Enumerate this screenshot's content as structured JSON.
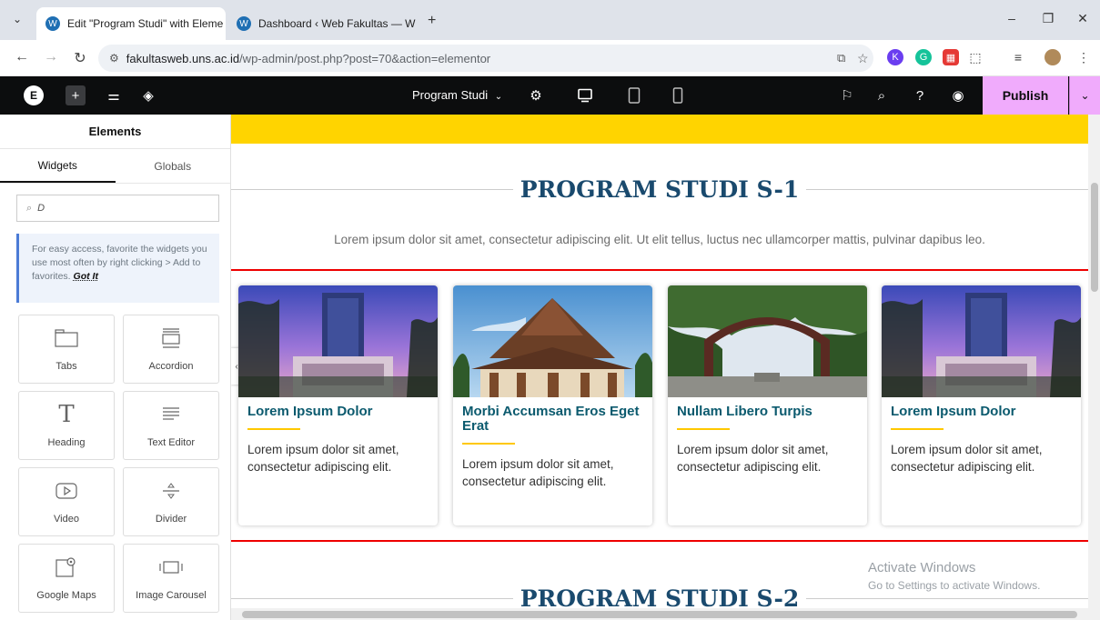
{
  "browser": {
    "tabs": [
      {
        "title": "Edit \"Program Studi\" with Eleme",
        "active": true
      },
      {
        "title": "Dashboard ‹ Web Fakultas — W",
        "active": false
      }
    ],
    "new_tab": "+",
    "url_host": "fakultasweb.uns.ac.id",
    "url_path": "/wp-admin/post.php?post=70&action=elementor"
  },
  "editor": {
    "document_name": "Program Studi",
    "publish_label": "Publish"
  },
  "panel": {
    "title": "Elements",
    "tabs": [
      "Widgets",
      "Globals"
    ],
    "search_value": "D",
    "note_text": "For easy access, favorite the widgets you use most often by right clicking > Add to favorites.",
    "note_link": "Got It",
    "widgets": [
      "Tabs",
      "Accordion",
      "Heading",
      "Text Editor",
      "Video",
      "Divider",
      "Google Maps",
      "Image Carousel"
    ]
  },
  "canvas": {
    "section1_title": "PROGRAM STUDI S-1",
    "section1_lead": "Lorem ipsum dolor sit amet, consectetur adipiscing elit. Ut elit tellus, luctus nec ullamcorper mattis, pulvinar dapibus leo.",
    "cards": [
      {
        "title": "Lorem Ipsum Dolor",
        "text": "Lorem ipsum dolor sit amet, consectetur adipiscing elit.",
        "image": "tower-building"
      },
      {
        "title": "Morbi Accumsan Eros Eget Erat",
        "text": "Lorem ipsum dolor sit amet, consectetur adipiscing elit.",
        "image": "joglo-pavilion"
      },
      {
        "title": "Nullam Libero Turpis",
        "text": "Lorem ipsum dolor sit amet, consectetur adipiscing elit.",
        "image": "campus-gate"
      },
      {
        "title": "Lorem Ipsum Dolor",
        "text": "Lorem ipsum dolor sit amet, consectetur adipiscing elit.",
        "image": "tower-building"
      }
    ],
    "section2_title": "PROGRAM STUDI S-2"
  },
  "watermark": {
    "line1": "Activate Windows",
    "line2": "Go to Settings to activate Windows."
  },
  "colors": {
    "accent_yellow": "#ffd400",
    "heading_blue": "#1a4a6e",
    "card_title": "#0b5a6e",
    "publish_bg": "#f0abfc",
    "selection_red": "#ee0000"
  }
}
